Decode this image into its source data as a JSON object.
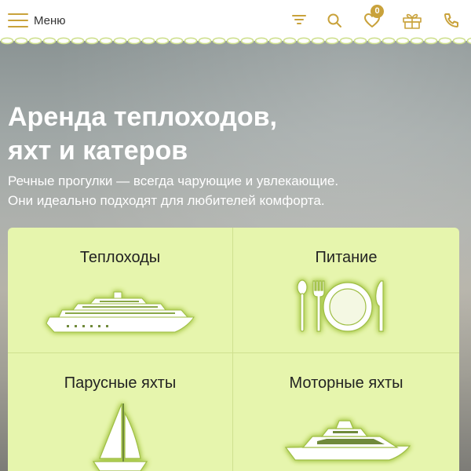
{
  "header": {
    "menu_label": "Меню",
    "favorites_count": "0",
    "icons": [
      "filter-icon",
      "search-icon",
      "heart-icon",
      "gift-icon",
      "phone-icon"
    ]
  },
  "hero": {
    "title_line1": "Аренда теплоходов,",
    "title_line2": "яхт и катеров",
    "subtitle_line1": "Речные прогулки — всегда чарующие и увлекающие.",
    "subtitle_line2": "Они идеально подходят для любителей комфорта."
  },
  "categories": [
    {
      "label": "Теплоходы",
      "icon": "motor-ship-icon"
    },
    {
      "label": "Питание",
      "icon": "cutlery-plate-icon"
    },
    {
      "label": "Парусные яхты",
      "icon": "sailboat-icon"
    },
    {
      "label": "Моторные яхты",
      "icon": "motor-yacht-icon"
    }
  ],
  "colors": {
    "accent": "#c9a23b",
    "card_background": "#e6f5ad",
    "header_background": "#ffffff",
    "illustration_fill": "#ffffff",
    "illustration_glow": "#b9d35a"
  }
}
